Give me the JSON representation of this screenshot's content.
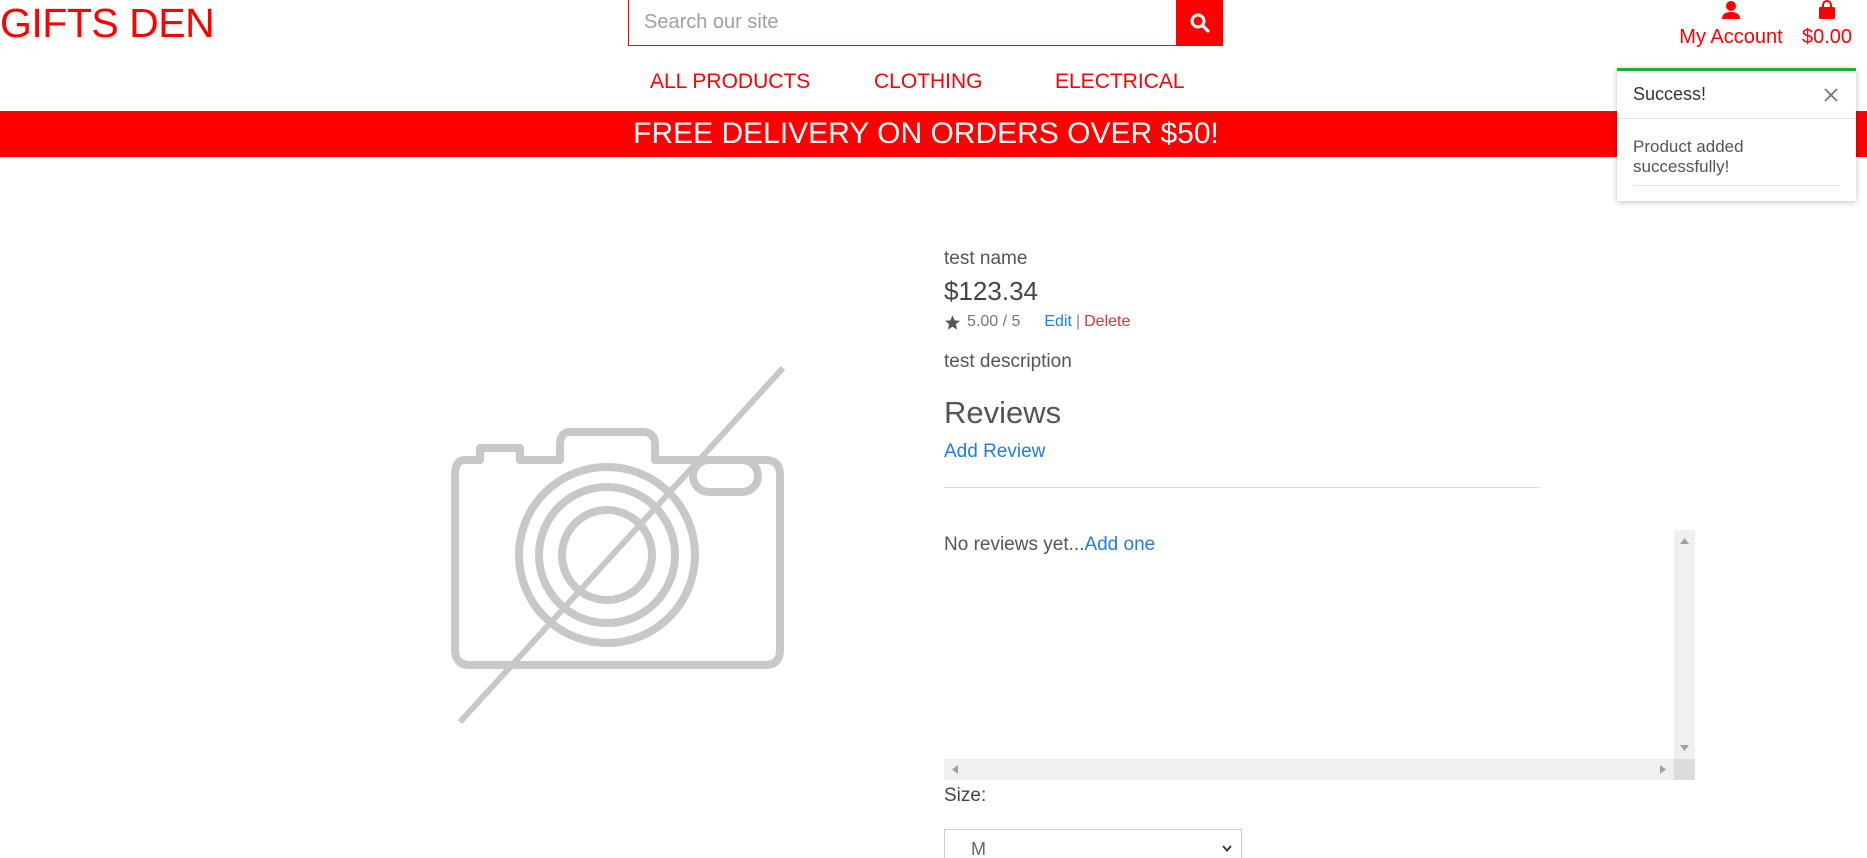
{
  "header": {
    "logo": "GIFTS DEN",
    "search_placeholder": "Search our site",
    "account_label": "My Account",
    "cart_total": "$0.00"
  },
  "nav": {
    "items": [
      "ALL PRODUCTS",
      "CLOTHING",
      "ELECTRICAL"
    ]
  },
  "banner": {
    "text": "FREE DELIVERY ON ORDERS OVER $50!"
  },
  "toast": {
    "title": "Success!",
    "message": "Product added successfully!",
    "accent_color": "#28a745"
  },
  "product": {
    "name": "test name",
    "price": "$123.34",
    "rating": "5.00 / 5",
    "edit_label": "Edit",
    "separator": "|",
    "delete_label": "Delete",
    "description": "test description",
    "reviews_heading": "Reviews",
    "add_review_label": "Add Review",
    "no_reviews_text": "No reviews yet...",
    "add_one_label": "Add one",
    "size_label": "Size:",
    "size_selected": "M",
    "image_icon": "no-image-camera-icon"
  },
  "colors": {
    "brand": "#ff0000",
    "link": "#1e7ee8",
    "danger": "#e03030"
  }
}
